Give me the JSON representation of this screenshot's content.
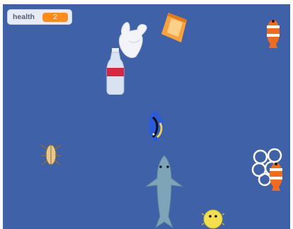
{
  "stage": {
    "background": "#3f61a7"
  },
  "health_monitor": {
    "label": "health",
    "value": "2",
    "value_color": "#ff8c1a"
  },
  "sprites": [
    "plastic-bag-icon",
    "chip-bag-icon",
    "plastic-bottle-icon",
    "clownfish-icon",
    "blue-tang-fish-icon",
    "shrimp-icon",
    "six-pack-rings-icon",
    "clownfish-icon",
    "shark-icon",
    "pufferfish-icon"
  ]
}
